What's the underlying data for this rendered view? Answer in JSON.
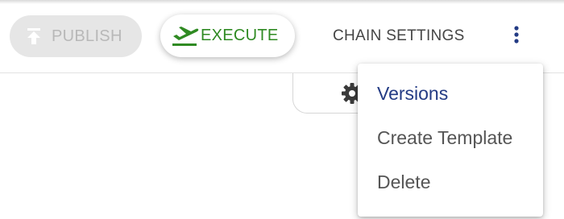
{
  "toolbar": {
    "publish": {
      "label": "PUBLISH",
      "icon": "publish-icon",
      "state": "disabled"
    },
    "execute": {
      "label": "EXECUTE",
      "icon": "flight-takeoff-icon",
      "color": "#2f8a22"
    },
    "chain_settings": {
      "label": "CHAIN SETTINGS"
    },
    "more": {
      "icon": "more-vert-icon",
      "color": "#233b84"
    }
  },
  "tab": {
    "icon": "gear-icon"
  },
  "menu": {
    "items": [
      {
        "label": "Versions",
        "active": true
      },
      {
        "label": "Create Template",
        "active": false
      },
      {
        "label": "Delete",
        "active": false
      }
    ],
    "active_color": "#233b84"
  }
}
